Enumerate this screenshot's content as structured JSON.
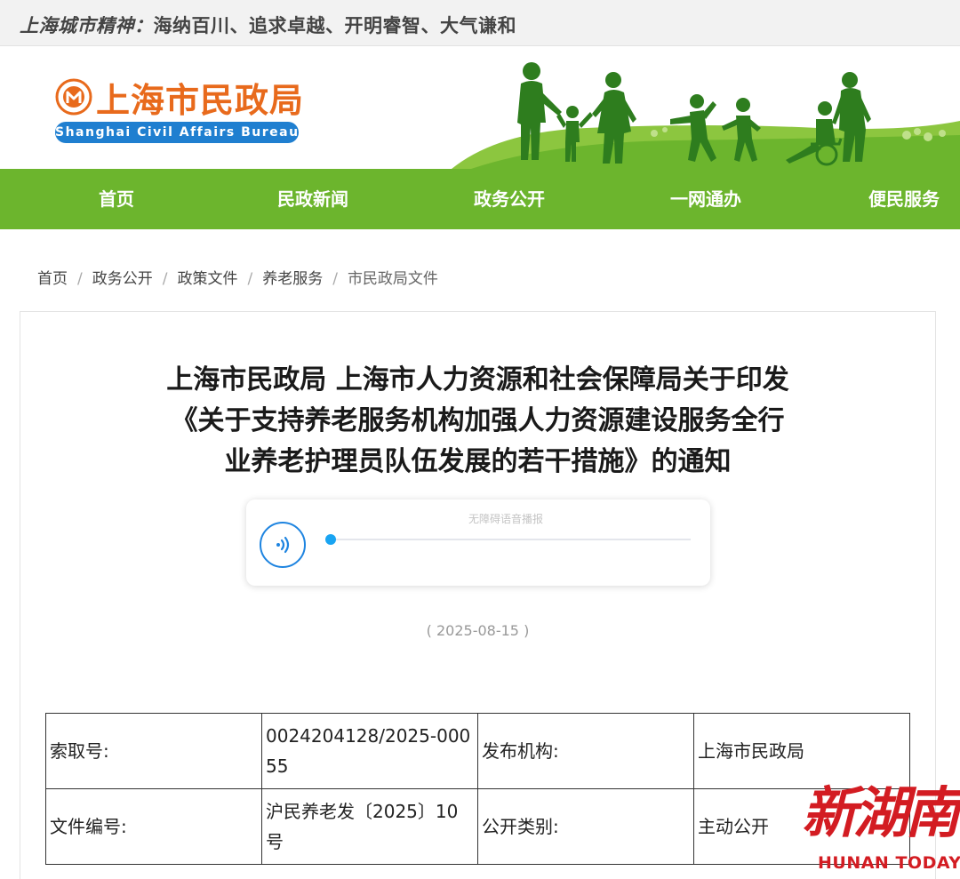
{
  "topbar": {
    "spirit_label": "上海城市精神：",
    "spirit_text": "海纳百川、追求卓越、开明睿智、大气谦和"
  },
  "header": {
    "logo_title": "上海市民政局",
    "logo_subtitle": "Shanghai Civil Affairs Bureau",
    "logo_color": "#e86a1c",
    "subtitle_bg": "#1f7fd0"
  },
  "nav": {
    "color": "#6cb52d",
    "items": [
      {
        "label": "首页"
      },
      {
        "label": "民政新闻"
      },
      {
        "label": "政务公开"
      },
      {
        "label": "一网通办"
      },
      {
        "label": "便民服务"
      }
    ]
  },
  "breadcrumb": {
    "items": [
      "首页",
      "政务公开",
      "政策文件",
      "养老服务",
      "市民政局文件"
    ]
  },
  "article": {
    "title_lines": [
      "上海市民政局 上海市人力资源和社会保障局关于印发",
      "《关于支持养老服务机构加强人力资源建设服务全行",
      "业养老护理员队伍发展的若干措施》的通知"
    ],
    "player_label": "无障碍语音播报",
    "player_progress": 0,
    "date": "( 2025-08-15 )"
  },
  "meta_table": {
    "rows": [
      [
        "索取号:",
        "0024204128/2025-00055",
        "发布机构:",
        "上海市民政局"
      ],
      [
        "文件编号:",
        "沪民养老发〔2025〕10号",
        "公开类别:",
        "主动公开"
      ]
    ]
  },
  "watermark": {
    "title": "新湖南",
    "subtitle": "HUNAN TODAY",
    "color": "#d31c22"
  }
}
